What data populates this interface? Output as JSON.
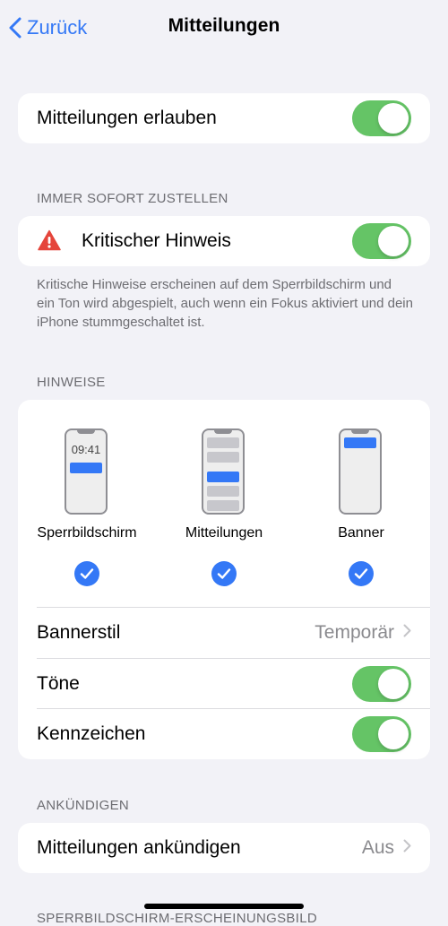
{
  "nav": {
    "back_label": "Zurück",
    "title": "Mitteilungen"
  },
  "allow": {
    "label": "Mitteilungen erlauben",
    "on": true
  },
  "immediate": {
    "header": "IMMER SOFORT ZUSTELLEN",
    "critical_label": "Kritischer Hinweis",
    "critical_on": true,
    "footnote": "Kritische Hinweise erscheinen auf dem Sperrbildschirm und ein Ton wird abgespielt, auch wenn ein Fokus aktiviert und dein iPhone stummgeschaltet ist."
  },
  "alerts": {
    "header": "HINWEISE",
    "options": [
      {
        "label": "Sperrbildschirm",
        "preview_time": "09:41",
        "checked": true
      },
      {
        "label": "Mitteilungen",
        "checked": true
      },
      {
        "label": "Banner",
        "checked": true
      }
    ],
    "banner_style_label": "Bannerstil",
    "banner_style_value": "Temporär",
    "sounds_label": "Töne",
    "sounds_on": true,
    "badges_label": "Kennzeichen",
    "badges_on": true
  },
  "announce": {
    "header": "ANKÜNDIGEN",
    "label": "Mitteilungen ankündigen",
    "value": "Aus"
  },
  "next_header": "SPERRBILDSCHIRM-ERSCHEINUNGSBILD",
  "colors": {
    "accent": "#3478f6",
    "toggle_on": "#65c466",
    "background": "#f2f2f7",
    "warning": "#e5453b"
  },
  "icons": {
    "back": "chevron-left-icon",
    "warning": "warning-triangle-icon",
    "disclosure": "chevron-right-icon",
    "check": "checkmark-circle-icon"
  }
}
